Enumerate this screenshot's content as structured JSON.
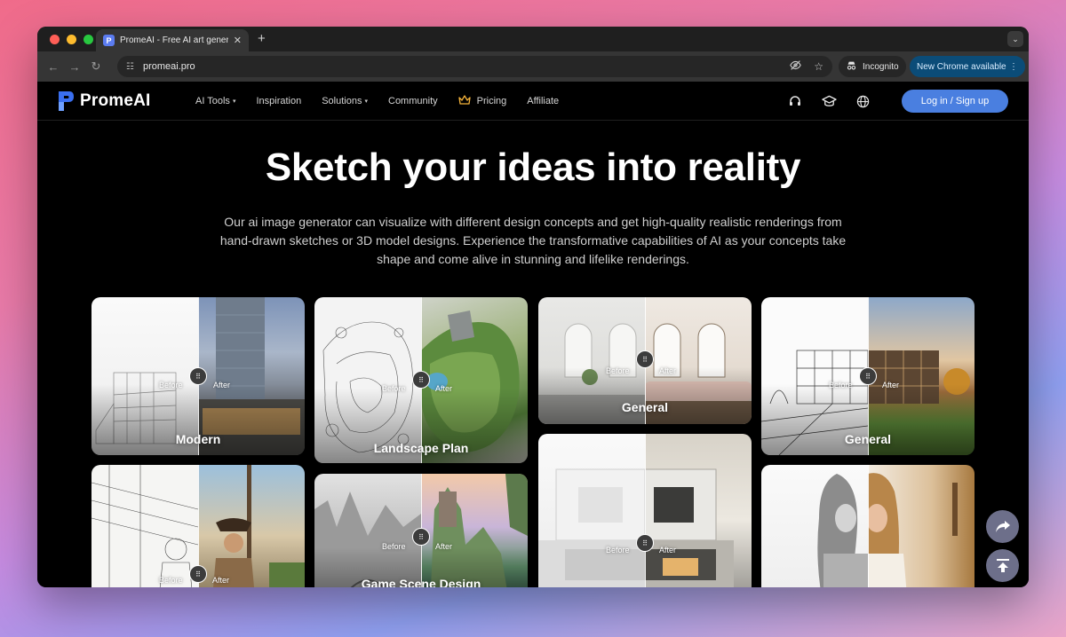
{
  "browser": {
    "tab_title": "PromeAI - Free AI art generat",
    "favicon_letter": "P",
    "url": "promeai.pro",
    "incognito_label": "Incognito",
    "new_chrome_label": "New Chrome available"
  },
  "site": {
    "brand": "PromeAI",
    "nav": {
      "ai_tools": "AI Tools",
      "inspiration": "Inspiration",
      "solutions": "Solutions",
      "community": "Community",
      "pricing": "Pricing",
      "affiliate": "Affiliate"
    },
    "login_label": "Log in / Sign up",
    "hero_title": "Sketch your ideas into reality",
    "hero_description": "Our ai image generator can visualize with different design concepts and get high-quality realistic renderings from hand-drawn sketches or 3D model designs. Experience the transformative capabilities of AI as your concepts take shape and come alive in stunning and lifelike renderings."
  },
  "gallery": {
    "before_label": "Before",
    "after_label": "After",
    "cards": [
      {
        "title": "Modern"
      },
      {
        "title": "Landscape Plan"
      },
      {
        "title": "General"
      },
      {
        "title": "General"
      },
      {
        "title": ""
      },
      {
        "title": "Game Scene Design"
      },
      {
        "title": ""
      },
      {
        "title": ""
      }
    ]
  },
  "icons": {
    "support": "headset-icon",
    "learn": "graduation-cap-icon",
    "language": "globe-icon",
    "share": "share-icon",
    "back_to_top": "back-to-top-icon"
  }
}
